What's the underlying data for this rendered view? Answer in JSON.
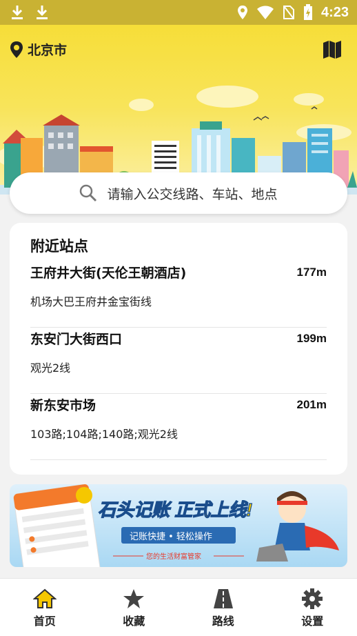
{
  "status_bar": {
    "time": "4:23"
  },
  "header": {
    "city": "北京市"
  },
  "search": {
    "placeholder": "请输入公交线路、车站、地点"
  },
  "nearby": {
    "title": "附近站点",
    "stops": [
      {
        "name": "王府井大街(天伦王朝酒店)",
        "distance": "177m",
        "lines": "机场大巴王府井金宝街线"
      },
      {
        "name": "东安门大街西口",
        "distance": "199m",
        "lines": "观光2线"
      },
      {
        "name": "新东安市场",
        "distance": "201m",
        "lines": "103路;104路;140路;观光2线"
      }
    ]
  },
  "banner": {
    "headline": "石头记账 正式上线!",
    "tagline": "记账快捷 • 轻松操作",
    "subline": "您的生活财富管家"
  },
  "bottom_nav": {
    "items": [
      {
        "label": "首页",
        "icon": "home-icon",
        "active": true
      },
      {
        "label": "收藏",
        "icon": "star-icon"
      },
      {
        "label": "路线",
        "icon": "road-icon"
      },
      {
        "label": "设置",
        "icon": "gear-icon"
      }
    ]
  },
  "colors": {
    "accent": "#f5c700",
    "status_bar": "#c9b233",
    "banner_red": "#e8392a"
  }
}
